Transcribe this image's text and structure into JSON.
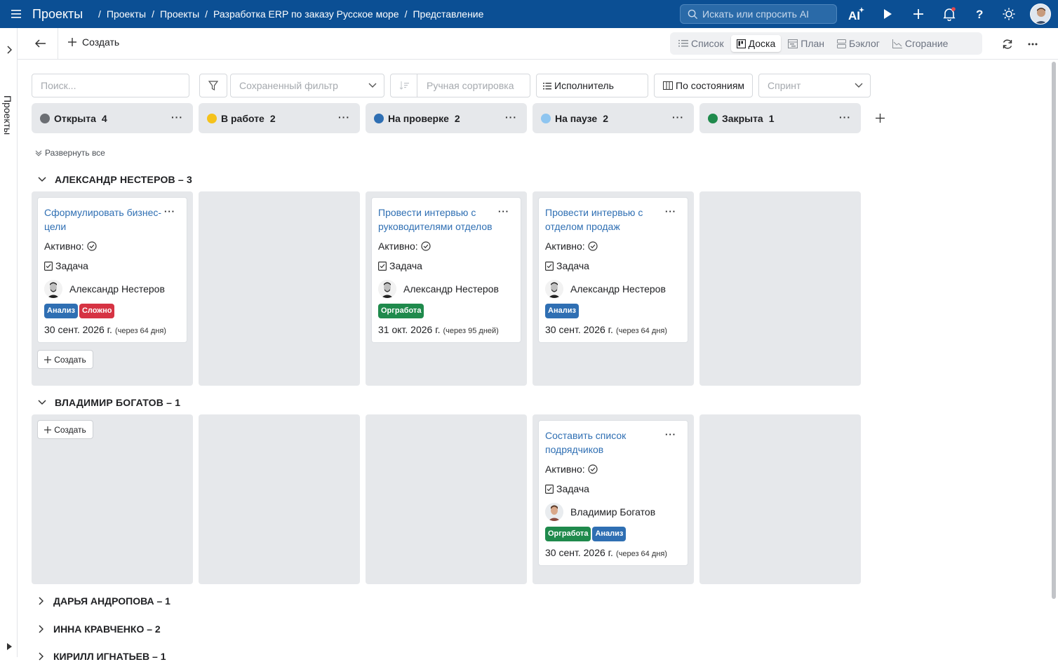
{
  "topbar": {
    "app_title": "Проекты",
    "breadcrumbs": [
      "Проекты",
      "Проекты",
      "Разработка ERP по заказу Русское море",
      "Представление"
    ],
    "search_placeholder": "Искать или спросить AI",
    "icons": [
      "menu-icon",
      "ai-sparkle-icon",
      "play-icon",
      "plus-icon",
      "bell-icon",
      "help-icon",
      "sun-icon"
    ]
  },
  "leftrail": {
    "label": "Проекты"
  },
  "toolbar": {
    "create_label": "Создать",
    "views": [
      "Список",
      "Доска",
      "План",
      "Бэклог",
      "Сгорание"
    ],
    "active_view": "Доска"
  },
  "filters": {
    "search_placeholder": "Поиск...",
    "saved_filter_placeholder": "Сохраненный фильтр",
    "sort_placeholder": "Ручная сортировка",
    "group_by": "Исполнитель",
    "columns_by": "По состояниям",
    "sprint_placeholder": "Спринт"
  },
  "columns": [
    {
      "name": "Открыта",
      "count": "4",
      "color": "#6b6e73"
    },
    {
      "name": "В работе",
      "count": "2",
      "color": "#f5c21b"
    },
    {
      "name": "На проверке",
      "count": "2",
      "color": "#2f6fb3"
    },
    {
      "name": "На паузе",
      "count": "2",
      "color": "#8ec5f0"
    },
    {
      "name": "Закрыта",
      "count": "1",
      "color": "#1f8a4c"
    }
  ],
  "expand_all": "Развернуть все",
  "groups": [
    {
      "title": "АЛЕКСАНДР НЕСТЕРОВ – 3",
      "cards": [
        {
          "title": "Сформулировать бизнес-цели",
          "active": "Активно:",
          "type": "Задача",
          "user": "Александр Нестеров",
          "tags": [
            "Анализ",
            "Сложно"
          ],
          "date": "30 сент. 2026 г.",
          "due": "(через 64 дня)"
        },
        {
          "title": "Провести интервью с руководителями отделов",
          "active": "Активно:",
          "type": "Задача",
          "user": "Александр Нестеров",
          "tags": [
            "Оргработа"
          ],
          "date": "31 окт. 2026 г.",
          "due": "(через 95 дней)"
        },
        {
          "title": "Провести интервью с отделом продаж",
          "active": "Активно:",
          "type": "Задача",
          "user": "Александр Нестеров",
          "tags": [
            "Анализ"
          ],
          "date": "30 сент. 2026 г.",
          "due": "(через 64 дня)"
        }
      ],
      "create_label": "Создать"
    },
    {
      "title": "ВЛАДИМИР БОГАТОВ – 1",
      "cards": [
        {
          "title": "Составить список подрядчиков",
          "active": "Активно:",
          "type": "Задача",
          "user": "Владимир Богатов",
          "tags": [
            "Оргработа",
            "Анализ"
          ],
          "date": "30 сент. 2026 г.",
          "due": "(через 64 дня)"
        }
      ],
      "create_label": "Создать"
    }
  ],
  "collapsed_groups": [
    "ДАРЬЯ АНДРОПОВА – 1",
    "ИННА КРАВЧЕНКО – 2",
    "КИРИЛЛ ИГНАТЬЕВ – 1"
  ],
  "tag_colors": {
    "Анализ": "#2f6fb3",
    "Сложно": "#d63343",
    "Оргработа": "#1f8a4c"
  }
}
